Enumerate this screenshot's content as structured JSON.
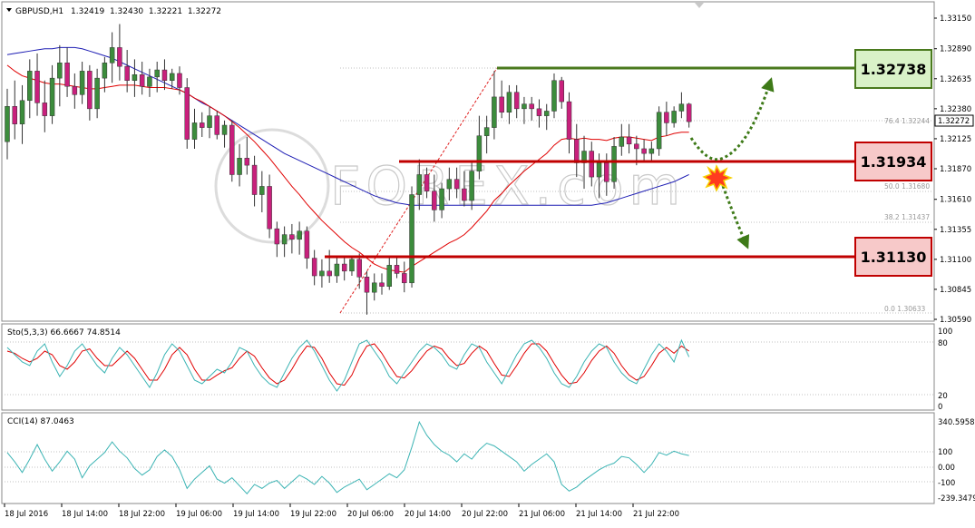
{
  "header": {
    "symbol": "GBPUSD,H1",
    "ohlc": "1.32419  1.32430  1.32221  1.32272"
  },
  "watermark": "FOREX.com",
  "price_axis": {
    "ticks": [
      "1.33150",
      "1.32890",
      "1.32635",
      "1.32380",
      "1.32125",
      "1.31870",
      "1.31610",
      "1.31355",
      "1.31100",
      "1.30845",
      "1.30590"
    ],
    "current": "1.32272"
  },
  "fib_labels": [
    "76.4  1.32244",
    "50.0  1.31680",
    "38.2  1.31437",
    "0.0  1.30633"
  ],
  "levels": [
    {
      "label": "1.32738",
      "color": "#4a7a1e",
      "fill": "#d9f2c8"
    },
    {
      "label": "1.31934",
      "color": "#c00000",
      "fill": "#f7c9c9"
    },
    {
      "label": "1.31130",
      "color": "#c00000",
      "fill": "#f7c9c9"
    }
  ],
  "stoch": {
    "label": "Sto(5,3,3) 66.6667 74.8514",
    "ticks": [
      "100",
      "80",
      "20",
      "0"
    ]
  },
  "cci": {
    "label": "CCI(14) 87.0463",
    "ticks": [
      "340.5958",
      "100",
      "0.00",
      "-100",
      "-239.3479"
    ]
  },
  "time_axis": [
    "18 Jul 2016",
    "18 Jul 14:00",
    "18 Jul 22:00",
    "19 Jul 06:00",
    "19 Jul 14:00",
    "19 Jul 22:00",
    "20 Jul 06:00",
    "20 Jul 14:00",
    "20 Jul 22:00",
    "21 Jul 06:00",
    "21 Jul 14:00",
    "21 Jul 22:00"
  ],
  "colors": {
    "bull": "#3c8c3c",
    "bear": "#c8207c",
    "ma_fast": "#e00000",
    "ma_slow": "#1e1eb4",
    "stoch_main": "#3cb4b4",
    "stoch_signal": "#e00000",
    "cci": "#3cb4b4"
  },
  "chart_data": {
    "type": "candlestick",
    "ylim": [
      1.3059,
      1.3315
    ],
    "candles": [
      [
        1.321,
        1.3255,
        1.3195,
        1.324
      ],
      [
        1.324,
        1.3262,
        1.3212,
        1.3225
      ],
      [
        1.3225,
        1.3258,
        1.3208,
        1.3245
      ],
      [
        1.3245,
        1.328,
        1.323,
        1.327
      ],
      [
        1.327,
        1.3285,
        1.3232,
        1.3243
      ],
      [
        1.3243,
        1.3262,
        1.3218,
        1.3232
      ],
      [
        1.3232,
        1.3275,
        1.3225,
        1.3264
      ],
      [
        1.3264,
        1.3292,
        1.324,
        1.3277
      ],
      [
        1.3277,
        1.329,
        1.3248,
        1.3257
      ],
      [
        1.3257,
        1.3268,
        1.3238,
        1.325
      ],
      [
        1.325,
        1.3278,
        1.3242,
        1.327
      ],
      [
        1.327,
        1.3275,
        1.3228,
        1.3238
      ],
      [
        1.3238,
        1.3272,
        1.323,
        1.3264
      ],
      [
        1.3264,
        1.3282,
        1.3252,
        1.3277
      ],
      [
        1.3277,
        1.3303,
        1.326,
        1.329
      ],
      [
        1.329,
        1.331,
        1.3262,
        1.3274
      ],
      [
        1.3274,
        1.3288,
        1.3252,
        1.3262
      ],
      [
        1.3262,
        1.328,
        1.3248,
        1.3267
      ],
      [
        1.3267,
        1.3278,
        1.325,
        1.3257
      ],
      [
        1.3257,
        1.3272,
        1.3248,
        1.3265
      ],
      [
        1.3265,
        1.3278,
        1.3252,
        1.3271
      ],
      [
        1.3271,
        1.328,
        1.3254,
        1.3262
      ],
      [
        1.3262,
        1.3272,
        1.3255,
        1.3268
      ],
      [
        1.3268,
        1.3274,
        1.325,
        1.3256
      ],
      [
        1.3256,
        1.3264,
        1.3204,
        1.3212
      ],
      [
        1.3212,
        1.3238,
        1.3204,
        1.3226
      ],
      [
        1.3226,
        1.3235,
        1.3214,
        1.3222
      ],
      [
        1.3222,
        1.324,
        1.3213,
        1.3232
      ],
      [
        1.3232,
        1.3236,
        1.3212,
        1.3216
      ],
      [
        1.3216,
        1.3228,
        1.3205,
        1.3224
      ],
      [
        1.3224,
        1.3228,
        1.3176,
        1.3182
      ],
      [
        1.3182,
        1.3208,
        1.3172,
        1.3196
      ],
      [
        1.3196,
        1.3214,
        1.3182,
        1.319
      ],
      [
        1.319,
        1.3198,
        1.3155,
        1.3165
      ],
      [
        1.3165,
        1.3185,
        1.315,
        1.3172
      ],
      [
        1.3172,
        1.3182,
        1.3128,
        1.3136
      ],
      [
        1.3136,
        1.3142,
        1.3112,
        1.3123
      ],
      [
        1.3123,
        1.3138,
        1.3112,
        1.3131
      ],
      [
        1.3131,
        1.314,
        1.3115,
        1.3127
      ],
      [
        1.3127,
        1.3142,
        1.3114,
        1.3134
      ],
      [
        1.3134,
        1.3138,
        1.3102,
        1.3111
      ],
      [
        1.3111,
        1.3118,
        1.3088,
        1.3096
      ],
      [
        1.3096,
        1.311,
        1.3086,
        1.31
      ],
      [
        1.31,
        1.3118,
        1.309,
        1.3096
      ],
      [
        1.3096,
        1.3112,
        1.309,
        1.3106
      ],
      [
        1.3106,
        1.3112,
        1.3092,
        1.31
      ],
      [
        1.31,
        1.3112,
        1.3096,
        1.311
      ],
      [
        1.311,
        1.3115,
        1.3085,
        1.3095
      ],
      [
        1.3095,
        1.31,
        1.3063,
        1.3082
      ],
      [
        1.3082,
        1.3098,
        1.3075,
        1.309
      ],
      [
        1.309,
        1.3098,
        1.308,
        1.3087
      ],
      [
        1.3087,
        1.3112,
        1.3084,
        1.3105
      ],
      [
        1.3105,
        1.3112,
        1.3094,
        1.3098
      ],
      [
        1.3098,
        1.3108,
        1.3082,
        1.309
      ],
      [
        1.309,
        1.3172,
        1.3086,
        1.3165
      ],
      [
        1.3165,
        1.3195,
        1.3152,
        1.3182
      ],
      [
        1.3182,
        1.3188,
        1.3162,
        1.3168
      ],
      [
        1.3168,
        1.3182,
        1.3142,
        1.3152
      ],
      [
        1.3152,
        1.3175,
        1.3145,
        1.317
      ],
      [
        1.317,
        1.3188,
        1.316,
        1.3178
      ],
      [
        1.3178,
        1.3188,
        1.3162,
        1.317
      ],
      [
        1.317,
        1.3185,
        1.3155,
        1.316
      ],
      [
        1.316,
        1.3192,
        1.3152,
        1.3185
      ],
      [
        1.3185,
        1.3232,
        1.3178,
        1.3215
      ],
      [
        1.3215,
        1.3232,
        1.32,
        1.3222
      ],
      [
        1.3222,
        1.327,
        1.3212,
        1.3248
      ],
      [
        1.3248,
        1.3262,
        1.323,
        1.3235
      ],
      [
        1.3235,
        1.3258,
        1.3225,
        1.3252
      ],
      [
        1.3252,
        1.3258,
        1.323,
        1.3238
      ],
      [
        1.3238,
        1.3248,
        1.3225,
        1.3242
      ],
      [
        1.3242,
        1.3248,
        1.3228,
        1.3238
      ],
      [
        1.3238,
        1.3246,
        1.3222,
        1.3232
      ],
      [
        1.3232,
        1.3242,
        1.322,
        1.3236
      ],
      [
        1.3236,
        1.3268,
        1.323,
        1.3262
      ],
      [
        1.3262,
        1.3265,
        1.3238,
        1.3244
      ],
      [
        1.3244,
        1.3252,
        1.32,
        1.3212
      ],
      [
        1.3212,
        1.3225,
        1.318,
        1.3192
      ],
      [
        1.3192,
        1.3215,
        1.317,
        1.3202
      ],
      [
        1.3202,
        1.321,
        1.3172,
        1.318
      ],
      [
        1.318,
        1.32,
        1.3162,
        1.3192
      ],
      [
        1.3192,
        1.32,
        1.3164,
        1.3176
      ],
      [
        1.3176,
        1.3214,
        1.317,
        1.3206
      ],
      [
        1.3206,
        1.3225,
        1.3198,
        1.3214
      ],
      [
        1.3214,
        1.3225,
        1.32,
        1.3208
      ],
      [
        1.3208,
        1.3215,
        1.319,
        1.3204
      ],
      [
        1.3204,
        1.3212,
        1.3194,
        1.32
      ],
      [
        1.32,
        1.321,
        1.3193,
        1.3204
      ],
      [
        1.3204,
        1.324,
        1.3198,
        1.3235
      ],
      [
        1.3235,
        1.3244,
        1.3215,
        1.3226
      ],
      [
        1.3226,
        1.324,
        1.3222,
        1.3236
      ],
      [
        1.3236,
        1.3252,
        1.323,
        1.3242
      ],
      [
        1.3242,
        1.3243,
        1.3222,
        1.3227
      ]
    ],
    "ma_fast": [
      1.3275,
      1.327,
      1.3266,
      1.3264,
      1.3262,
      1.326,
      1.3259,
      1.3259,
      1.3258,
      1.3257,
      1.3256,
      1.3255,
      1.3255,
      1.3256,
      1.3257,
      1.3258,
      1.3258,
      1.3258,
      1.3257,
      1.3256,
      1.3256,
      1.3256,
      1.3255,
      1.3254,
      1.3251,
      1.3247,
      1.3244,
      1.324,
      1.3236,
      1.3232,
      1.3227,
      1.3222,
      1.3216,
      1.321,
      1.3203,
      1.3196,
      1.3188,
      1.318,
      1.3172,
      1.3165,
      1.3157,
      1.315,
      1.3143,
      1.3137,
      1.3131,
      1.3125,
      1.312,
      1.3116,
      1.3111,
      1.3106,
      1.3103,
      1.3101,
      1.31,
      1.3099,
      1.3104,
      1.3108,
      1.3112,
      1.3116,
      1.312,
      1.3124,
      1.3127,
      1.3131,
      1.3137,
      1.3144,
      1.3151,
      1.316,
      1.3166,
      1.3173,
      1.3179,
      1.3185,
      1.319,
      1.3195,
      1.32,
      1.3207,
      1.3212,
      1.3213,
      1.3212,
      1.3213,
      1.3212,
      1.3212,
      1.3211,
      1.3213,
      1.3214,
      1.3214,
      1.3213,
      1.3212,
      1.3211,
      1.3214,
      1.3215,
      1.3217,
      1.3218,
      1.3218
    ],
    "ma_slow": [
      1.3284,
      1.3285,
      1.3286,
      1.3287,
      1.3288,
      1.3289,
      1.3289,
      1.329,
      1.329,
      1.329,
      1.3289,
      1.3287,
      1.3285,
      1.3283,
      1.3281,
      1.3278,
      1.3275,
      1.3272,
      1.3269,
      1.3266,
      1.3263,
      1.326,
      1.3257,
      1.3254,
      1.3251,
      1.3247,
      1.3243,
      1.324,
      1.3236,
      1.3232,
      1.3228,
      1.3224,
      1.322,
      1.3216,
      1.3212,
      1.3208,
      1.3204,
      1.32,
      1.3197,
      1.3194,
      1.3191,
      1.3188,
      1.3185,
      1.3182,
      1.3179,
      1.3176,
      1.3173,
      1.317,
      1.3167,
      1.3164,
      1.3162,
      1.316,
      1.3158,
      1.3157,
      1.3156,
      1.3156,
      1.3156,
      1.3156,
      1.3156,
      1.3156,
      1.3156,
      1.3156,
      1.3156,
      1.3156,
      1.3156,
      1.3156,
      1.3156,
      1.3156,
      1.3156,
      1.3156,
      1.3156,
      1.3156,
      1.3156,
      1.3156,
      1.3156,
      1.3156,
      1.3156,
      1.3156,
      1.3156,
      1.3157,
      1.3158,
      1.316,
      1.3162,
      1.3164,
      1.3166,
      1.3168,
      1.317,
      1.3172,
      1.3174,
      1.3176,
      1.3179,
      1.3182
    ],
    "stoch_main": [
      80,
      70,
      60,
      55,
      75,
      85,
      60,
      40,
      55,
      75,
      85,
      70,
      55,
      45,
      65,
      80,
      70,
      55,
      40,
      25,
      45,
      70,
      85,
      75,
      55,
      35,
      30,
      40,
      50,
      45,
      60,
      80,
      75,
      55,
      40,
      30,
      25,
      45,
      65,
      80,
      90,
      75,
      55,
      35,
      20,
      35,
      60,
      85,
      90,
      75,
      60,
      40,
      30,
      45,
      60,
      75,
      85,
      80,
      70,
      55,
      50,
      70,
      85,
      80,
      60,
      45,
      30,
      50,
      70,
      85,
      90,
      80,
      65,
      45,
      30,
      25,
      40,
      60,
      75,
      85,
      80,
      60,
      45,
      35,
      30,
      50,
      70,
      85,
      75,
      60,
      90,
      67
    ],
    "stoch_signal": [
      75,
      72,
      65,
      60,
      65,
      75,
      70,
      55,
      50,
      60,
      75,
      78,
      65,
      55,
      55,
      65,
      75,
      65,
      50,
      35,
      35,
      50,
      70,
      80,
      70,
      50,
      35,
      35,
      42,
      48,
      52,
      65,
      75,
      68,
      52,
      38,
      30,
      35,
      50,
      68,
      82,
      80,
      65,
      45,
      30,
      28,
      42,
      65,
      82,
      85,
      72,
      55,
      40,
      38,
      48,
      62,
      75,
      82,
      78,
      65,
      55,
      58,
      72,
      82,
      75,
      58,
      42,
      40,
      55,
      72,
      85,
      85,
      75,
      58,
      42,
      30,
      32,
      45,
      62,
      75,
      82,
      72,
      55,
      42,
      35,
      40,
      55,
      72,
      80,
      72,
      82,
      75
    ],
    "cci": [
      110,
      40,
      -40,
      60,
      170,
      60,
      -30,
      40,
      120,
      60,
      -80,
      10,
      60,
      110,
      190,
      120,
      70,
      -10,
      -60,
      -20,
      80,
      130,
      80,
      -20,
      -160,
      -90,
      -40,
      10,
      -90,
      -120,
      -80,
      -140,
      -200,
      -130,
      -160,
      -120,
      -100,
      -160,
      -110,
      -60,
      -90,
      -130,
      -70,
      -120,
      -190,
      -150,
      -120,
      -90,
      -170,
      -130,
      -90,
      -50,
      -80,
      -20,
      150,
      340,
      240,
      170,
      120,
      90,
      40,
      100,
      60,
      130,
      180,
      160,
      120,
      80,
      40,
      -30,
      20,
      60,
      100,
      40,
      -130,
      -180,
      -150,
      -100,
      -60,
      -20,
      10,
      30,
      80,
      70,
      20,
      -40,
      20,
      110,
      90,
      120,
      100,
      87
    ]
  }
}
